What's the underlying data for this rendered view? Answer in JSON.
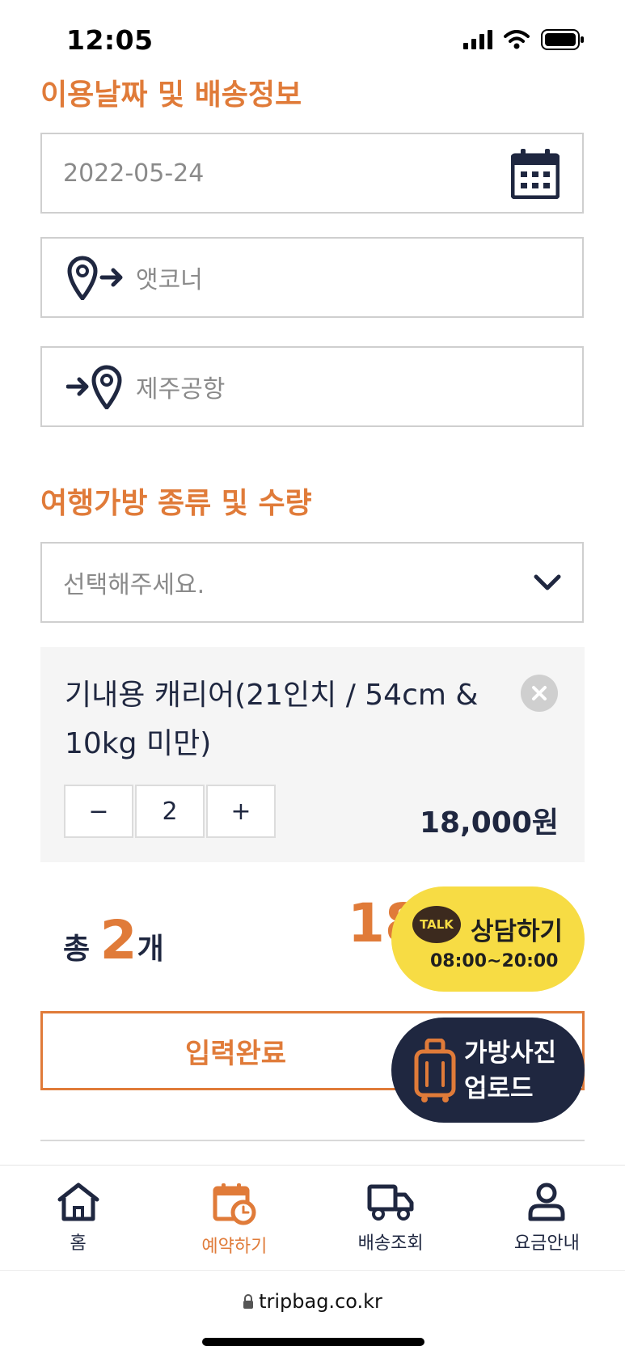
{
  "status_bar": {
    "time": "12:05"
  },
  "sections": {
    "date_delivery_title": "이용날짜 및 배송정보",
    "bag_title": "여행가방 종류 및 수량"
  },
  "form": {
    "date_value": "2022-05-24",
    "origin_value": "앳코너",
    "destination_value": "제주공항",
    "bag_select_placeholder": "선택해주세요."
  },
  "item": {
    "name": "기내용 캐리어(21인치 / 54cm & 10kg 미만)",
    "minus": "−",
    "quantity": "2",
    "plus": "+",
    "price": "18,000원"
  },
  "total": {
    "prefix": "총",
    "count": "2",
    "suffix": "개",
    "price_partial": "18"
  },
  "submit_label": "입력완료",
  "talk_fab": {
    "badge": "TALK",
    "label": "상담하기",
    "hours": "08:00~20:00"
  },
  "upload_fab": {
    "label": "가방사진 업로드"
  },
  "nav": [
    {
      "label": "홈",
      "icon": "home-icon"
    },
    {
      "label": "예약하기",
      "icon": "calendar-clock-icon"
    },
    {
      "label": "배송조회",
      "icon": "truck-icon"
    },
    {
      "label": "요금안내",
      "icon": "user-icon"
    }
  ],
  "browser": {
    "url": "tripbag.co.kr"
  },
  "colors": {
    "accent": "#e07b39",
    "navy": "#1f2740",
    "kakao": "#f7dc44"
  }
}
